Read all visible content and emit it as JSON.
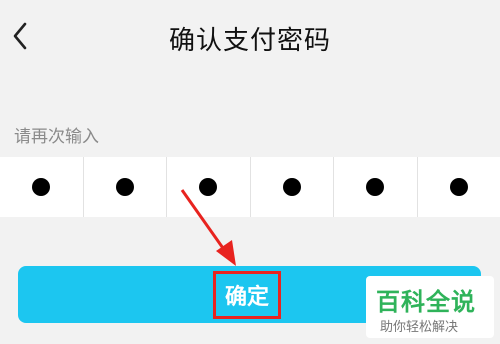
{
  "header": {
    "back_icon": "chevron-left-icon",
    "title": "确认支付密码"
  },
  "hint": "请再次输入",
  "pin": {
    "length": 6,
    "filled": 6
  },
  "confirm_button": {
    "label": "确定"
  },
  "watermark": {
    "main": "百科全说",
    "sub": "助你轻松解决"
  },
  "colors": {
    "button": "#1cc6f0",
    "highlight_box": "#e8231f",
    "watermark_text": "#2fb35a"
  }
}
